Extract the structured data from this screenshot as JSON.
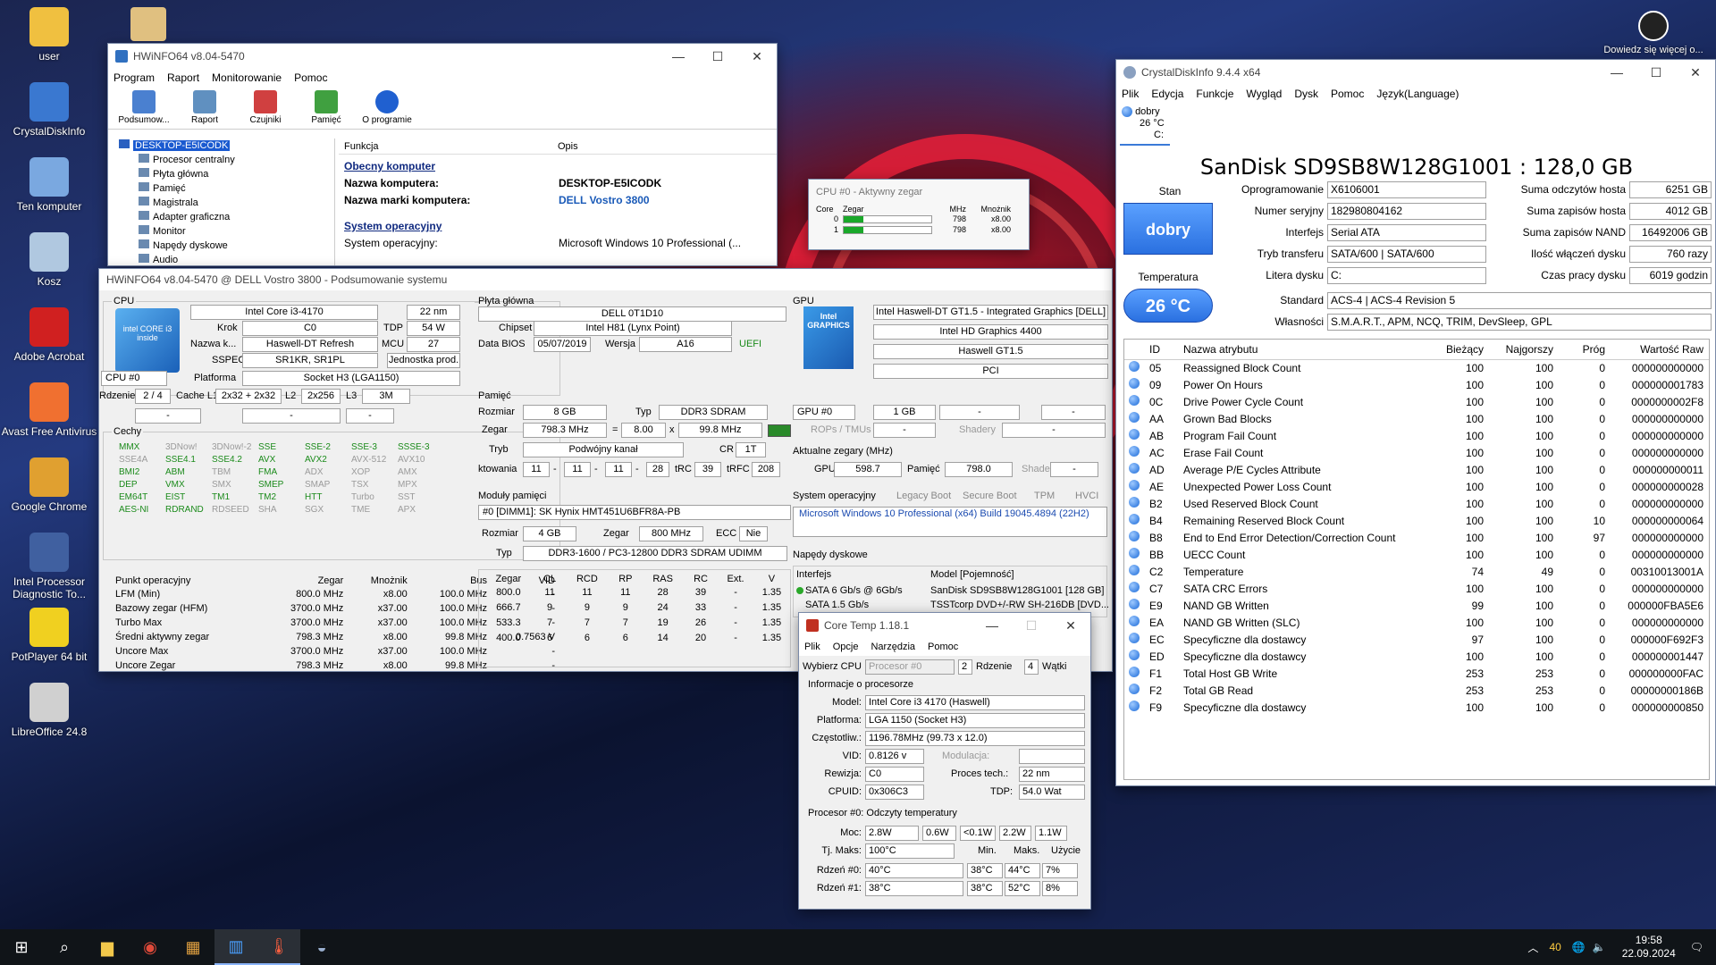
{
  "desktop": {
    "icons": [
      "user",
      "CrystalDiskInfo",
      "Ten komputer",
      "Kosz",
      "Adobe Acrobat",
      "Avast Free Antivirus",
      "Google Chrome",
      "Intel Processor Diagnostic To...",
      "PotPlayer 64 bit",
      "LibreOffice 24.8"
    ],
    "corner_text": "Dowiedz się więcej o..."
  },
  "hwinfo": {
    "title": "HWiNFO64 v8.04-5470",
    "menu": [
      "Program",
      "Raport",
      "Monitorowanie",
      "Pomoc"
    ],
    "toolbar": [
      "Podsumow...",
      "Raport",
      "Czujniki",
      "Pamięć",
      "O programie"
    ],
    "tree": [
      "DESKTOP-E5ICODK",
      "Procesor centralny",
      "Płyta główna",
      "Pamięć",
      "Magistrala",
      "Adapter graficzna",
      "Monitor",
      "Napędy dyskowe",
      "Audio"
    ],
    "col_func": "Funkcja",
    "col_desc": "Opis",
    "sec_computer": "Obecny komputer",
    "k_name": "Nazwa komputera:",
    "v_name": "DESKTOP-E5ICODK",
    "k_brand": "Nazwa marki komputera:",
    "v_brand": "DELL Vostro 3800",
    "sec_os": "System operacyjny",
    "k_os": "System operacyjny:",
    "v_os": "Microsoft Windows 10 Professional (..."
  },
  "summary": {
    "title": "HWiNFO64 v8.04-5470 @ DELL Vostro 3800 - Podsumowanie systemu",
    "cpu": {
      "grp": "CPU",
      "name": "Intel Core i3-4170",
      "nm": "22 nm",
      "l_krok": "Krok",
      "krok": "C0",
      "l_tdp": "TDP",
      "tdp": "54 W",
      "l_nazwa": "Nazwa k...",
      "nazwa": "Haswell-DT Refresh",
      "l_mcu": "MCU",
      "mcu": "27",
      "l_sspec": "SSPEC",
      "sspec": "SR1KR, SR1PL",
      "prod": "Jednostka prod.",
      "sel": "CPU #0",
      "l_plat": "Platforma",
      "plat": "Socket H3 (LGA1150)",
      "l_rdz": "Rdzenie",
      "rdz": "2 / 4",
      "l_l1": "Cache L1",
      "l1": "2x32 + 2x32",
      "l_l2": "L2",
      "l2": "2x256",
      "l_l3": "L3",
      "l3": "3M",
      "d1": "-",
      "d2": "-",
      "d3": "-",
      "badge": "intel CORE i3 inside"
    },
    "features_label": "Cechy",
    "features": [
      [
        "MMX",
        "on"
      ],
      [
        "3DNow!",
        "off"
      ],
      [
        "3DNow!-2",
        "off"
      ],
      [
        "SSE",
        "on"
      ],
      [
        "SSE-2",
        "on"
      ],
      [
        "SSE-3",
        "on"
      ],
      [
        "SSSE-3",
        "on"
      ],
      [
        "SSE4A",
        "off"
      ],
      [
        "SSE4.1",
        "on"
      ],
      [
        "SSE4.2",
        "on"
      ],
      [
        "AVX",
        "on"
      ],
      [
        "AVX2",
        "on"
      ],
      [
        "AVX-512",
        "off"
      ],
      [
        "AVX10",
        "off"
      ],
      [
        "BMI2",
        "on"
      ],
      [
        "ABM",
        "on"
      ],
      [
        "TBM",
        "off"
      ],
      [
        "FMA",
        "on"
      ],
      [
        "ADX",
        "off"
      ],
      [
        "XOP",
        "off"
      ],
      [
        "AMX",
        "off"
      ],
      [
        "DEP",
        "on"
      ],
      [
        "VMX",
        "on"
      ],
      [
        "SMX",
        "off"
      ],
      [
        "SMEP",
        "on"
      ],
      [
        "SMAP",
        "off"
      ],
      [
        "TSX",
        "off"
      ],
      [
        "MPX",
        "off"
      ],
      [
        "EM64T",
        "on"
      ],
      [
        "EIST",
        "on"
      ],
      [
        "TM1",
        "on"
      ],
      [
        "TM2",
        "on"
      ],
      [
        "HTT",
        "on"
      ],
      [
        "Turbo",
        "off"
      ],
      [
        "SST",
        "off"
      ],
      [
        "AES-NI",
        "on"
      ],
      [
        "RDRAND",
        "on"
      ],
      [
        "RDSEED",
        "off"
      ],
      [
        "SHA",
        "off"
      ],
      [
        "SGX",
        "off"
      ],
      [
        "TME",
        "off"
      ],
      [
        "APX",
        "off"
      ]
    ],
    "op_head": [
      "Punkt operacyjny",
      "Zegar",
      "Mnożnik",
      "Bus",
      "VID"
    ],
    "op_rows": [
      [
        "LFM (Min)",
        "800.0 MHz",
        "x8.00",
        "100.0 MHz",
        "-"
      ],
      [
        "Bazowy zegar (HFM)",
        "3700.0 MHz",
        "x37.00",
        "100.0 MHz",
        "-"
      ],
      [
        "Turbo Max",
        "3700.0 MHz",
        "x37.00",
        "100.0 MHz",
        "-"
      ],
      [
        "Średni aktywny zegar",
        "798.3 MHz",
        "x8.00",
        "99.8 MHz",
        "0.7563 V"
      ],
      [
        "Uncore Max",
        "3700.0 MHz",
        "x37.00",
        "100.0 MHz",
        "-"
      ],
      [
        "Uncore Zegar",
        "798.3 MHz",
        "x8.00",
        "99.8 MHz",
        "-"
      ]
    ],
    "mb": {
      "grp": "Płyta główna",
      "name": "DELL 0T1D10",
      "l_chip": "Chipset",
      "chip": "Intel H81 (Lynx Point)",
      "l_bios": "Data BIOS",
      "bios": "05/07/2019",
      "l_wer": "Wersja",
      "wer": "A16",
      "uefi": "UEFI"
    },
    "mem": {
      "grp": "Pamięć",
      "l_roz": "Rozmiar",
      "roz": "8 GB",
      "l_typ": "Typ",
      "typ": "DDR3 SDRAM",
      "l_zeg": "Zegar",
      "zeg": "798.3 MHz",
      "eq": "=",
      "mult": "8.00",
      "x": "x",
      "bus": "99.8 MHz",
      "l_tryb": "Tryb",
      "tryb": "Podwójny kanał",
      "l_cr": "CR",
      "cr": "1T",
      "l_tim": "ktowania",
      "t1": "11",
      "t2": "11",
      "t3": "11",
      "t4": "28",
      "l_trc": "tRC",
      "trc": "39",
      "l_trfc": "tRFC",
      "trfc": "208"
    },
    "mod": {
      "grp": "Moduły pamięci",
      "sel": "#0 [DIMM1]: SK Hynix HMT451U6BFR8A-PB",
      "l_roz": "Rozmiar",
      "roz": "4 GB",
      "l_zeg": "Zegar",
      "zeg": "800 MHz",
      "l_ecc": "ECC",
      "ecc": "Nie",
      "l_typ": "Typ",
      "typ": "DDR3-1600 / PC3-12800 DDR3 SDRAM UDIMM",
      "head": [
        "Zegar",
        "CL",
        "RCD",
        "RP",
        "RAS",
        "RC",
        "Ext.",
        "V"
      ],
      "rows": [
        [
          "800.0",
          "11",
          "11",
          "11",
          "28",
          "39",
          "-",
          "1.35"
        ],
        [
          "666.7",
          "9",
          "9",
          "9",
          "24",
          "33",
          "-",
          "1.35"
        ],
        [
          "533.3",
          "7",
          "7",
          "7",
          "19",
          "26",
          "-",
          "1.35"
        ],
        [
          "400.0",
          "6",
          "6",
          "6",
          "14",
          "20",
          "-",
          "1.35"
        ]
      ]
    },
    "gpu": {
      "grp": "GPU",
      "name": "Intel Haswell-DT GT1.5 - Integrated Graphics [DELL]",
      "model": "Intel HD Graphics 4400",
      "core": "Haswell GT1.5",
      "bus": "PCI",
      "sel": "GPU #0",
      "mem": "1 GB",
      "d1": "-",
      "d2": "-",
      "l_rops": "ROPs / TMUs",
      "d3": "-",
      "l_shad": "Shadery",
      "d4": "-",
      "clk_label": "Aktualne zegary (MHz)",
      "l_gpu": "GPU",
      "gclk": "598.7",
      "l_pam": "Pamięć",
      "mclk": "798.0",
      "l_shader": "Shader",
      "sclk": "-",
      "badge": "Intel GRAPHICS"
    },
    "os": {
      "grp": "System operacyjny",
      "flags": [
        "Legacy Boot",
        "Secure Boot",
        "TPM",
        "HVCI"
      ],
      "value": "Microsoft Windows 10 Professional (x64) Build 19045.4894 (22H2)"
    },
    "drv": {
      "grp": "Napędy dyskowe",
      "h_if": "Interfejs",
      "h_model": "Model [Pojemność]",
      "rows": [
        [
          "SATA 6 Gb/s @ 6Gb/s",
          "SanDisk SD9SB8W128G1001 [128 GB]"
        ],
        [
          "SATA 1.5 Gb/s",
          "TSSTcorp DVD+/-RW SH-216DB [DVD..."
        ]
      ]
    }
  },
  "clockwin": {
    "title": "CPU #0 - Aktywny zegar",
    "head": [
      "Core",
      "Zegar",
      "MHz",
      "Mnożnik"
    ],
    "rows": [
      {
        "core": "0",
        "mhz": "798",
        "mul": "x8.00",
        "fill": 0.22
      },
      {
        "core": "1",
        "mhz": "798",
        "mul": "x8.00",
        "fill": 0.22
      }
    ]
  },
  "crystal": {
    "title": "CrystalDiskInfo 9.4.4 x64",
    "menu": [
      "Plik",
      "Edycja",
      "Funkcje",
      "Wygląd",
      "Dysk",
      "Pomoc",
      "Język(Language)"
    ],
    "tab_status": "dobry",
    "tab_temp": "26 °C",
    "tab_drive": "C:",
    "heading": "SanDisk SD9SB8W128G1001 : 128,0 GB",
    "l_stan": "Stan",
    "stan": "dobry",
    "l_temp": "Temperatura",
    "temp": "26 °C",
    "left": [
      [
        "Oprogramowanie",
        "X6106001"
      ],
      [
        "Numer seryjny",
        "182980804162"
      ],
      [
        "Interfejs",
        "Serial ATA"
      ],
      [
        "Tryb transferu",
        "SATA/600 | SATA/600"
      ],
      [
        "Litera dysku",
        "C:"
      ]
    ],
    "right": [
      [
        "Suma odczytów hosta",
        "6251 GB"
      ],
      [
        "Suma zapisów hosta",
        "4012 GB"
      ],
      [
        "Suma zapisów NAND",
        "16492006 GB"
      ],
      [
        "Ilość włączeń dysku",
        "760 razy"
      ],
      [
        "Czas pracy dysku",
        "6019 godzin"
      ]
    ],
    "l_standard": "Standard",
    "standard": "ACS-4 | ACS-4 Revision 5",
    "l_wlas": "Własności",
    "wlas": "S.M.A.R.T., APM, NCQ, TRIM, DevSleep, GPL",
    "smart_head": [
      "ID",
      "Nazwa atrybutu",
      "Bieżący",
      "Najgorszy",
      "Próg",
      "Wartość Raw"
    ],
    "smart": [
      [
        "05",
        "Reassigned Block Count",
        "100",
        "100",
        "0",
        "000000000000"
      ],
      [
        "09",
        "Power On Hours",
        "100",
        "100",
        "0",
        "000000001783"
      ],
      [
        "0C",
        "Drive Power Cycle Count",
        "100",
        "100",
        "0",
        "0000000002F8"
      ],
      [
        "AA",
        "Grown Bad Blocks",
        "100",
        "100",
        "0",
        "000000000000"
      ],
      [
        "AB",
        "Program Fail Count",
        "100",
        "100",
        "0",
        "000000000000"
      ],
      [
        "AC",
        "Erase Fail Count",
        "100",
        "100",
        "0",
        "000000000000"
      ],
      [
        "AD",
        "Average P/E Cycles Attribute",
        "100",
        "100",
        "0",
        "000000000011"
      ],
      [
        "AE",
        "Unexpected Power Loss Count",
        "100",
        "100",
        "0",
        "000000000028"
      ],
      [
        "B2",
        "Used Reserved Block Count",
        "100",
        "100",
        "0",
        "000000000000"
      ],
      [
        "B4",
        "Remaining Reserved Block Count",
        "100",
        "100",
        "10",
        "000000000064"
      ],
      [
        "B8",
        "End to End Error Detection/Correction Count",
        "100",
        "100",
        "97",
        "000000000000"
      ],
      [
        "BB",
        "UECC Count",
        "100",
        "100",
        "0",
        "000000000000"
      ],
      [
        "C2",
        "Temperature",
        "74",
        "49",
        "0",
        "00310013001A"
      ],
      [
        "C7",
        "SATA CRC Errors",
        "100",
        "100",
        "0",
        "000000000000"
      ],
      [
        "E9",
        "NAND GB Written",
        "99",
        "100",
        "0",
        "000000FBA5E6"
      ],
      [
        "EA",
        "NAND GB Written (SLC)",
        "100",
        "100",
        "0",
        "000000000000"
      ],
      [
        "EC",
        "Specyficzne dla dostawcy",
        "97",
        "100",
        "0",
        "000000F692F3"
      ],
      [
        "ED",
        "Specyficzne dla dostawcy",
        "100",
        "100",
        "0",
        "000000001447"
      ],
      [
        "F1",
        "Total Host GB Write",
        "253",
        "253",
        "0",
        "000000000FAC"
      ],
      [
        "F2",
        "Total GB Read",
        "253",
        "253",
        "0",
        "00000000186B"
      ],
      [
        "F9",
        "Specyficzne dla dostawcy",
        "100",
        "100",
        "0",
        "000000000850"
      ]
    ]
  },
  "coretemp": {
    "title": "Core Temp 1.18.1",
    "menu": [
      "Plik",
      "Opcje",
      "Narzędzia",
      "Pomoc"
    ],
    "l_sel": "Wybierz CPU",
    "sel": "Procesor #0",
    "cores": "2",
    "l_cores": "Rdzenie",
    "threads": "4",
    "l_threads": "Wątki",
    "info": "Informacje o procesorze",
    "l_model": "Model:",
    "model": "Intel Core i3 4170 (Haswell)",
    "l_plat": "Platforma:",
    "plat": "LGA 1150 (Socket H3)",
    "l_freq": "Częstotliw.:",
    "freq": "1196.78MHz (99.73 x 12.0)",
    "l_vid": "VID:",
    "vid": "0.8126 v",
    "l_mod": "Modulacja:",
    "l_rev": "Rewizja:",
    "rev": "C0",
    "l_tech": "Proces tech.:",
    "tech": "22 nm",
    "l_cpuid": "CPUID:",
    "cpuid": "0x306C3",
    "l_tdp": "TDP:",
    "tdp": "54.0 Wat",
    "readings": "Procesor #0: Odczyty temperatury",
    "l_moc": "Moc:",
    "p1": "2.8W",
    "p2": "0.6W",
    "p3": "<0.1W",
    "p4": "2.2W",
    "p5": "1.1W",
    "l_tj": "Tj. Maks:",
    "tj": "100°C",
    "h_min": "Min.",
    "h_max": "Maks.",
    "h_use": "Użycie",
    "rows": [
      [
        "Rdzeń #0:",
        "40°C",
        "38°C",
        "44°C",
        "7%"
      ],
      [
        "Rdzeń #1:",
        "38°C",
        "38°C",
        "52°C",
        "8%"
      ]
    ]
  },
  "taskbar": {
    "temp": "40",
    "time": "19:58",
    "date": "22.09.2024"
  }
}
